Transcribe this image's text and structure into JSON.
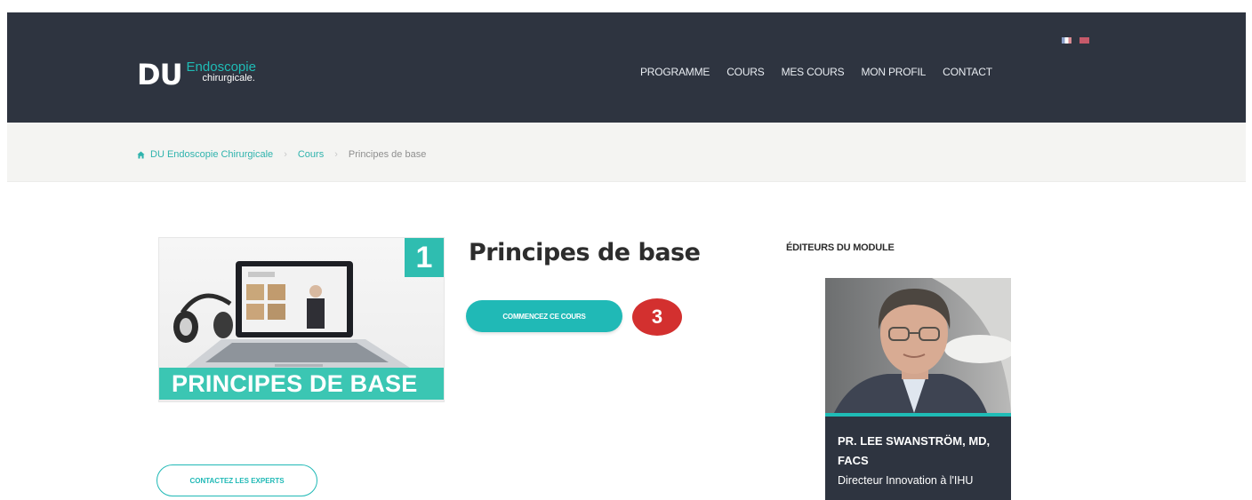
{
  "header": {
    "logo": {
      "main": "DU",
      "line1": "Endoscopie",
      "line2": "chirurgicale."
    },
    "languages": [
      {
        "code": "fr",
        "icon": "french-flag-icon"
      },
      {
        "code": "en",
        "icon": "english-flag-icon"
      }
    ],
    "nav": [
      "PROGRAMME",
      "COURS",
      "MES COURS",
      "MON PROFIL",
      "CONTACT"
    ]
  },
  "breadcrumb": {
    "home_icon": "home-icon",
    "items": [
      "DU Endoscopie Chirurgicale",
      "Cours",
      "Principes de base"
    ],
    "separator": "›"
  },
  "course": {
    "title": "Principes de base",
    "thumbnail_number": "1",
    "thumbnail_caption": "PRINCIPES DE BASE",
    "start_button": "COMMENCEZ CE COURS",
    "step_badge": "3",
    "contact_button": "CONTACTEZ LES EXPERTS"
  },
  "editors": {
    "heading": "ÉDITEURS DU MODULE",
    "items": [
      {
        "name": "PR. LEE SWANSTRÖM, MD, FACS",
        "role": "Directeur Innovation à l'IHU"
      }
    ]
  },
  "colors": {
    "header_bg": "#2e3440",
    "accent": "#20b9b6",
    "badge": "#d3302f",
    "breadcrumb_bg": "#f4f4f2"
  }
}
